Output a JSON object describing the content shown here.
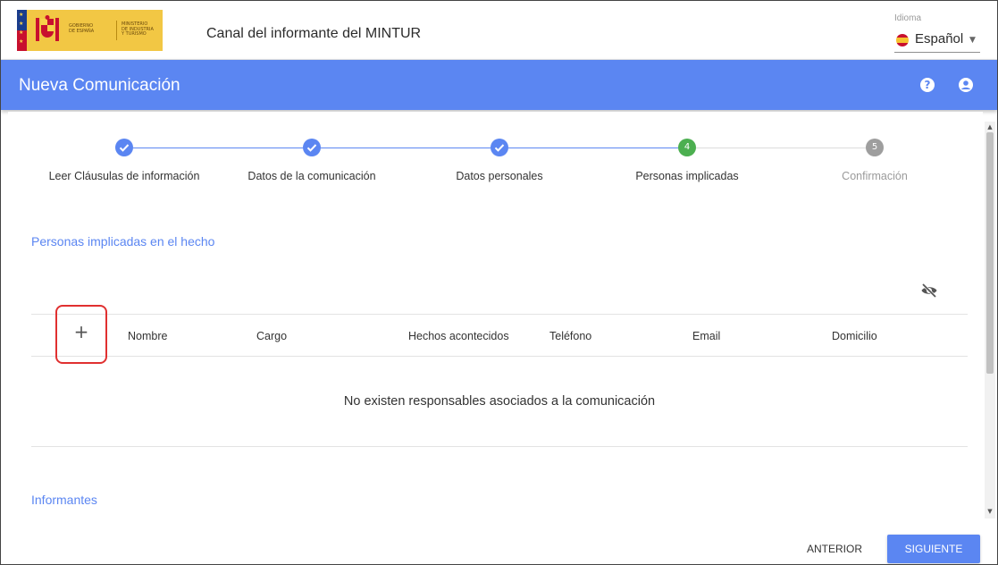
{
  "header": {
    "app_title": "Canal del informante del MINTUR",
    "logo": {
      "line1": "GOBIERNO",
      "line2": "DE ESPAÑA",
      "line3": "MINISTERIO",
      "line4": "DE INDUSTRIA",
      "line5": "Y TURISMO"
    },
    "language": {
      "label": "Idioma",
      "value": "Español",
      "icon": "spain-flag-icon"
    }
  },
  "bluebar": {
    "title": "Nueva Comunicación",
    "help_icon": "help-icon",
    "account_icon": "account-icon"
  },
  "stepper": {
    "steps": [
      {
        "label": "Leer Cláusulas de información",
        "state": "done"
      },
      {
        "label": "Datos de la comunicación",
        "state": "done"
      },
      {
        "label": "Datos personales",
        "state": "done"
      },
      {
        "label": "Personas implicadas",
        "state": "active",
        "number": "4"
      },
      {
        "label": "Confirmación",
        "state": "pending",
        "number": "5"
      }
    ]
  },
  "section_personas": {
    "title": "Personas implicadas en el hecho",
    "columns": [
      "Nombre",
      "Cargo",
      "Hechos acontecidos",
      "Teléfono",
      "Email",
      "Domicilio"
    ],
    "add_icon_label": "+",
    "empty_message": "No existen responsables asociados a la comunicación"
  },
  "section_informantes": {
    "title": "Informantes"
  },
  "footer": {
    "prev_label": "ANTERIOR",
    "next_label": "SIGUIENTE"
  },
  "colors": {
    "primary": "#5b86f2",
    "success": "#4caf50",
    "pending": "#9e9e9e",
    "highlight": "#e03030"
  }
}
